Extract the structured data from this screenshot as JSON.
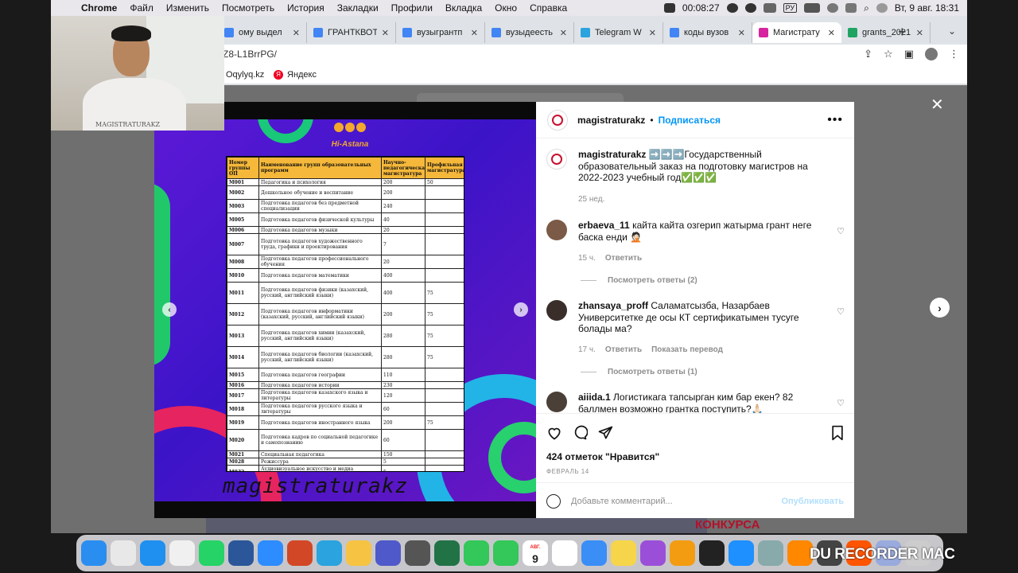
{
  "menubar": {
    "app": "Chrome",
    "items": [
      "Файл",
      "Изменить",
      "Посмотреть",
      "История",
      "Закладки",
      "Профили",
      "Вкладка",
      "Окно",
      "Справка"
    ],
    "timer": "00:08:27",
    "lang": "РУ",
    "datetime": "Вт, 9 авг.  18:31"
  },
  "tabs": [
    {
      "title": "ому выдел",
      "fav": "doc",
      "color": "#4285f4"
    },
    {
      "title": "ГРАНТКВОТ",
      "fav": "doc",
      "color": "#4285f4"
    },
    {
      "title": "вузыгрантп",
      "fav": "doc",
      "color": "#4285f4"
    },
    {
      "title": "вузыдеесть",
      "fav": "doc",
      "color": "#4285f4"
    },
    {
      "title": "Telegram W",
      "fav": "tg",
      "color": "#2aa3df"
    },
    {
      "title": "коды вузов",
      "fav": "doc",
      "color": "#4285f4"
    },
    {
      "title": "Магистрату",
      "fav": "ig",
      "color": "#d6249f"
    },
    {
      "title": "grants_2021",
      "fav": "drive",
      "color": "#1fa463"
    }
  ],
  "address": "Z8-L1BrrPG/",
  "bookmarks": [
    "Oqylyq.kz",
    "Яндекс"
  ],
  "post": {
    "username": "magistraturakz",
    "follow": "Подписаться",
    "caption_user": "magistraturakz",
    "caption": "➡️➡️➡️Государственный образовательный заказ на подготовку магистров на 2022-2023 учебный год✅✅✅",
    "caption_time": "25 нед.",
    "comments": [
      {
        "user": "erbaeva_11",
        "text": "кайта кайта озгерип жатырма грант неге баска енди 🤦🏻",
        "time": "15 ч.",
        "reply": "Ответить",
        "extra": "",
        "view_replies": "Посмотреть ответы (2)"
      },
      {
        "user": "zhansaya_proff",
        "text": "Саламатсызба, Назарбаев Университетке де осы КТ сертификатымен тусуге болады ма?",
        "time": "17 ч.",
        "reply": "Ответить",
        "extra": "Показать перевод",
        "view_replies": "Посмотреть ответы (1)"
      },
      {
        "user": "aiiida.1",
        "text": "Логистикага тапсырган ким бар екен? 82 баллмен возможно грантка поступить?🙏🏻",
        "time": "",
        "reply": "",
        "extra": "",
        "view_replies": ""
      }
    ],
    "likes": "424 отметок \"Нравится\"",
    "date": "ФЕВРАЛЬ 14",
    "add_comment_placeholder": "Добавьте комментарий...",
    "publish": "Опубликовать"
  },
  "slide": {
    "logo_text": "Hi-Astana",
    "watermark": "magistraturakz",
    "headers": [
      "Номер группы ОП",
      "Наименование групп образовательных программ",
      "Научно-педагогическая магистратура",
      "Профильная магистратура"
    ],
    "rows": [
      [
        "M001",
        "Педагогика и психология",
        "200",
        "50"
      ],
      [
        "M002",
        "Дошкольное обучение и воспитание",
        "200",
        ""
      ],
      [
        "M003",
        "Подготовка педагогов без предметной специализации",
        "240",
        ""
      ],
      [
        "M005",
        "Подготовка педагогов физической культуры",
        "40",
        ""
      ],
      [
        "M006",
        "Подготовка педагогов музыки",
        "20",
        ""
      ],
      [
        "M007",
        "Подготовка педагогов художественного труда, графики и проектирования",
        "7",
        ""
      ],
      [
        "M008",
        "Подготовка педагогов профессионального обучения",
        "20",
        ""
      ],
      [
        "M010",
        "Подготовка педагогов математики",
        "400",
        ""
      ],
      [
        "M011",
        "Подготовка педагогов физики (казахский, русский, английский языки)",
        "400",
        "75"
      ],
      [
        "M012",
        "Подготовка педагогов информатики (казахский, русский, английский языки)",
        "200",
        "75"
      ],
      [
        "M013",
        "Подготовка педагогов химии (казахский, русский, английский языки)",
        "280",
        "75"
      ],
      [
        "M014",
        "Подготовка педагогов биологии (казахский, русский, английский языки)",
        "280",
        "75"
      ],
      [
        "M015",
        "Подготовка педагогов географии",
        "110",
        ""
      ],
      [
        "M016",
        "Подготовка педагогов истории",
        "230",
        ""
      ],
      [
        "M017",
        "Подготовка педагогов казахского языка и литературы",
        "120",
        ""
      ],
      [
        "M018",
        "Подготовка педагогов русского языка и литературы",
        "60",
        ""
      ],
      [
        "M019",
        "Подготовка педагогов иностранного языка",
        "200",
        "75"
      ],
      [
        "M020",
        "Подготовка кадров по социальной педагогике и самопознанию",
        "60",
        ""
      ],
      [
        "M021",
        "Специальная педагогика",
        "150",
        ""
      ],
      [
        "M028",
        "Режиссура",
        "5",
        ""
      ],
      [
        "M032",
        "Аудиовизуальное искусство и медиа производство",
        "5",
        ""
      ],
      [
        "M035",
        "Мода, дизайн",
        "80",
        ""
      ],
      [
        "M036",
        "Полиграфия",
        "10",
        ""
      ]
    ]
  },
  "dock": {
    "calendar_month": "АВГ.",
    "calendar_day": "9",
    "recorder": "DU RECORDER MAC"
  },
  "behind": {
    "konkursa": "КОНКУРСА"
  },
  "webcam": {
    "shirt_text": "MAGISTRATURAKZ"
  }
}
